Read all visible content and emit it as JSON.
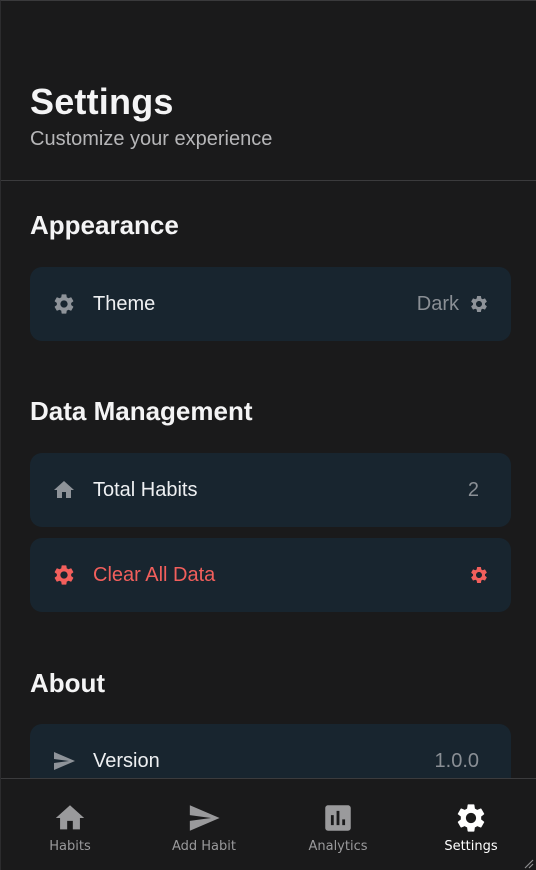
{
  "header": {
    "title": "Settings",
    "subtitle": "Customize your experience"
  },
  "sections": {
    "appearance": {
      "title": "Appearance",
      "theme": {
        "label": "Theme",
        "value": "Dark",
        "icon": "gear-icon",
        "trailing_icon": "gear-icon"
      }
    },
    "data_management": {
      "title": "Data Management",
      "total_habits": {
        "label": "Total Habits",
        "value": "2",
        "icon": "home-icon"
      },
      "clear_all": {
        "label": "Clear All Data",
        "icon": "gear-icon",
        "trailing_icon": "gear-icon"
      }
    },
    "about": {
      "title": "About",
      "version": {
        "label": "Version",
        "value": "1.0.0",
        "icon": "send-icon"
      }
    }
  },
  "bottom_nav": {
    "items": [
      {
        "label": "Habits",
        "icon": "home-icon",
        "active": false
      },
      {
        "label": "Add Habit",
        "icon": "send-icon",
        "active": false
      },
      {
        "label": "Analytics",
        "icon": "bar-chart-icon",
        "active": false
      },
      {
        "label": "Settings",
        "icon": "gear-icon",
        "active": true
      }
    ]
  },
  "colors": {
    "background": "#1a1a1b",
    "card": "#18252f",
    "danger": "#f25f5c",
    "muted_text": "#8a8f95",
    "icon_gray": "#8e9399",
    "active_nav": "#ffffff"
  }
}
